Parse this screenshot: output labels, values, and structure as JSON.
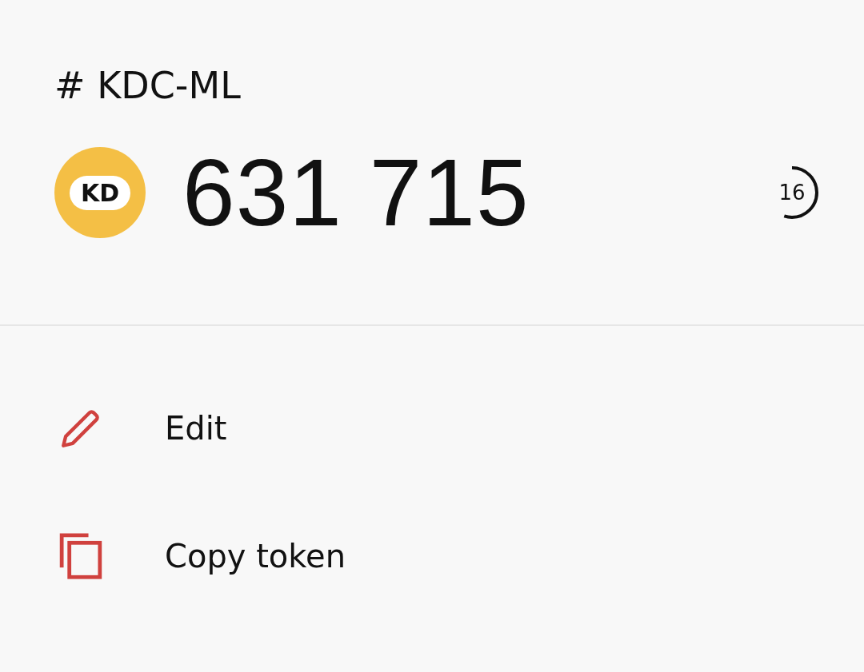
{
  "account": {
    "title": "# KDC-ML",
    "avatar": {
      "initials": "KD",
      "color": "#f4bf45"
    },
    "code": "631 715",
    "timer": {
      "seconds": "16",
      "level": 0.55
    }
  },
  "actions": [
    {
      "kind": "edit",
      "label": "Edit"
    },
    {
      "kind": "copy",
      "label": "Copy token"
    }
  ]
}
